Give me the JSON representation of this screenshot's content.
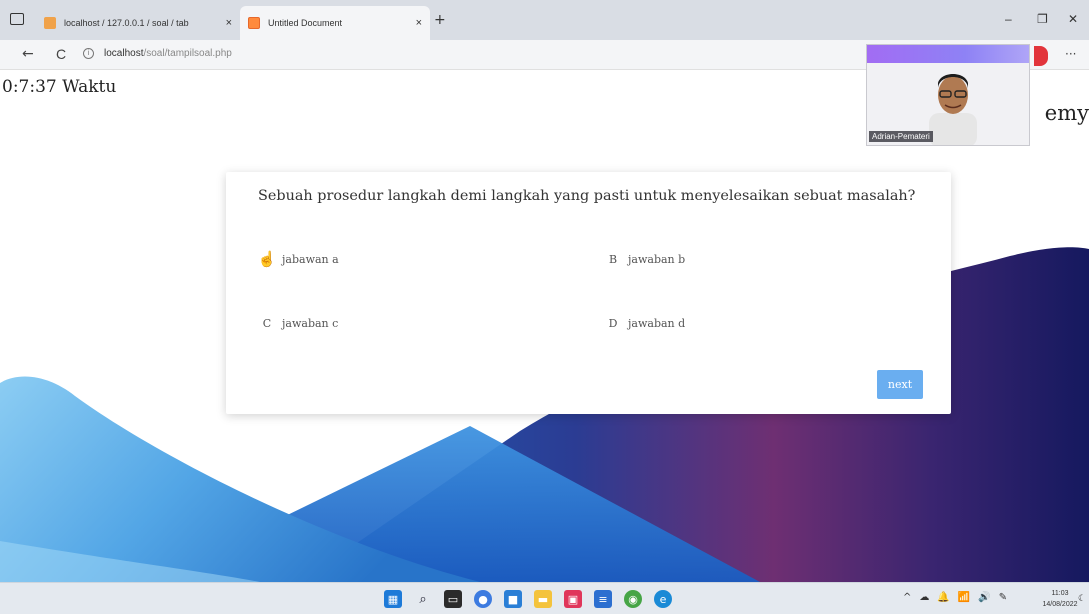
{
  "browser": {
    "tabs": [
      {
        "title": "localhost / 127.0.0.1 / soal / tab",
        "close": "×"
      },
      {
        "title": "Untitled Document",
        "close": "×"
      }
    ],
    "new_tab": "+",
    "window_controls": {
      "minimize": "–",
      "restore": "❐",
      "close": "✕"
    },
    "nav": {
      "back": "←",
      "reload": "C"
    },
    "url": {
      "host": "localhost",
      "path": "/soal/tampilsoal.php"
    },
    "more": "···"
  },
  "page": {
    "timer": "0:7:37 Waktu",
    "brand_fragment": "emy"
  },
  "quiz": {
    "question": "Sebuah prosedur langkah demi langkah yang pasti untuk menyelesaikan sebuat masalah?",
    "options": [
      {
        "key": "A",
        "label": "jabawan a"
      },
      {
        "key": "B",
        "label": "jawaban b"
      },
      {
        "key": "C",
        "label": "jawaban c"
      },
      {
        "key": "D",
        "label": "jawaban d"
      }
    ],
    "next_label": "next"
  },
  "webcam": {
    "name": "Adrian-Pemateri"
  },
  "taskbar": {
    "time": "11:03",
    "date": "14/08/2022",
    "tray": [
      "^",
      "☁",
      "🔔",
      "📶",
      "🔊",
      "✎"
    ],
    "notification": "☾"
  },
  "colors": {
    "next_button": "#6aaef0",
    "wave_light_blue": "#7cc4f0",
    "wave_dark_navy": "#1a1f6e",
    "wave_purple": "#7a2d6a"
  }
}
